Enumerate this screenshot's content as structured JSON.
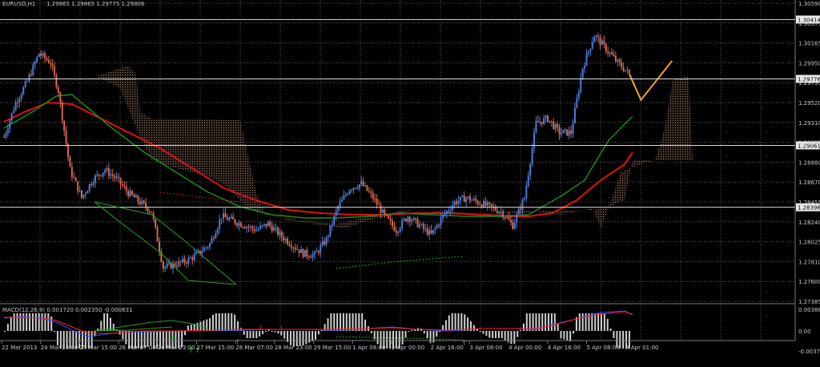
{
  "header": {
    "symbol_label": "EURUSD,H1",
    "ohlc": "1.29865 1.29865 1.29775 1.29806"
  },
  "macd": {
    "label": "MACD(12,26,9) 0.001720 0.002350 -0.000631",
    "scale": [
      "0.00388",
      "0.00",
      "-0.00379"
    ]
  },
  "chart_data": {
    "type": "candlestick",
    "symbol": "EURUSD",
    "timeframe": "H1",
    "ylim": [
      1.27385,
      1.3059
    ],
    "y_ticks": [
      "1.30590",
      "1.30375",
      "1.30165",
      "1.29950",
      "1.29735",
      "1.29520",
      "1.29310",
      "1.29095",
      "1.28880",
      "1.28670",
      "1.28455",
      "1.28240",
      "1.28025",
      "1.27810",
      "1.27600",
      "1.27385"
    ],
    "x_ticks": [
      "22 Mar 2013",
      "24 Mar 23:00",
      "25 Mar 15:00",
      "26 Mar 07:00",
      "26 Mar 23:00",
      "27 Mar 15:00",
      "28 Mar 07:00",
      "28 Mar 23:00",
      "29 Mar 15:00",
      "1 Apr 08:00",
      "2 Apr 00:00",
      "2 Apr 16:00",
      "3 Apr 08:00",
      "4 Apr 00:00",
      "4 Apr 16:00",
      "5 Apr 08:00",
      "8 Apr 01:00"
    ],
    "horizontal_levels": [
      {
        "value": 1.30414,
        "label": "1.30414"
      },
      {
        "value": 1.29776,
        "label": "1.29776"
      },
      {
        "value": 1.29061,
        "label": "1.29061"
      },
      {
        "value": 1.28396,
        "label": "1.28396"
      }
    ],
    "price_path": [
      [
        0,
        1.2915
      ],
      [
        3,
        1.2952
      ],
      [
        6,
        1.2975
      ],
      [
        9,
        1.3005
      ],
      [
        12,
        1.2995
      ],
      [
        14,
        1.2965
      ],
      [
        17,
        1.288
      ],
      [
        20,
        1.285
      ],
      [
        23,
        1.287
      ],
      [
        26,
        1.288
      ],
      [
        29,
        1.287
      ],
      [
        32,
        1.2855
      ],
      [
        35,
        1.2845
      ],
      [
        38,
        1.2835
      ],
      [
        41,
        1.2775
      ],
      [
        44,
        1.2778
      ],
      [
        47,
        1.2782
      ],
      [
        50,
        1.279
      ],
      [
        53,
        1.28
      ],
      [
        56,
        1.283
      ],
      [
        59,
        1.2825
      ],
      [
        62,
        1.282
      ],
      [
        65,
        1.2815
      ],
      [
        68,
        1.2822
      ],
      [
        71,
        1.281
      ],
      [
        74,
        1.28
      ],
      [
        77,
        1.279
      ],
      [
        80,
        1.2788
      ],
      [
        83,
        1.2805
      ],
      [
        86,
        1.284
      ],
      [
        89,
        1.286
      ],
      [
        92,
        1.2865
      ],
      [
        95,
        1.285
      ],
      [
        98,
        1.283
      ],
      [
        101,
        1.2815
      ],
      [
        104,
        1.283
      ],
      [
        107,
        1.282
      ],
      [
        110,
        1.281
      ],
      [
        113,
        1.283
      ],
      [
        116,
        1.2845
      ],
      [
        119,
        1.285
      ],
      [
        122,
        1.2845
      ],
      [
        125,
        1.284
      ],
      [
        128,
        1.2835
      ],
      [
        131,
        1.282
      ],
      [
        134,
        1.285
      ],
      [
        137,
        1.293
      ],
      [
        140,
        1.2935
      ],
      [
        143,
        1.292
      ],
      [
        146,
        1.292
      ],
      [
        149,
        1.299
      ],
      [
        152,
        1.3025
      ],
      [
        155,
        1.301
      ],
      [
        158,
        1.2995
      ],
      [
        161,
        1.2983
      ]
    ],
    "projection_path": [
      [
        161,
        1.2983
      ],
      [
        164,
        1.2955
      ],
      [
        172,
        1.2997
      ]
    ]
  }
}
